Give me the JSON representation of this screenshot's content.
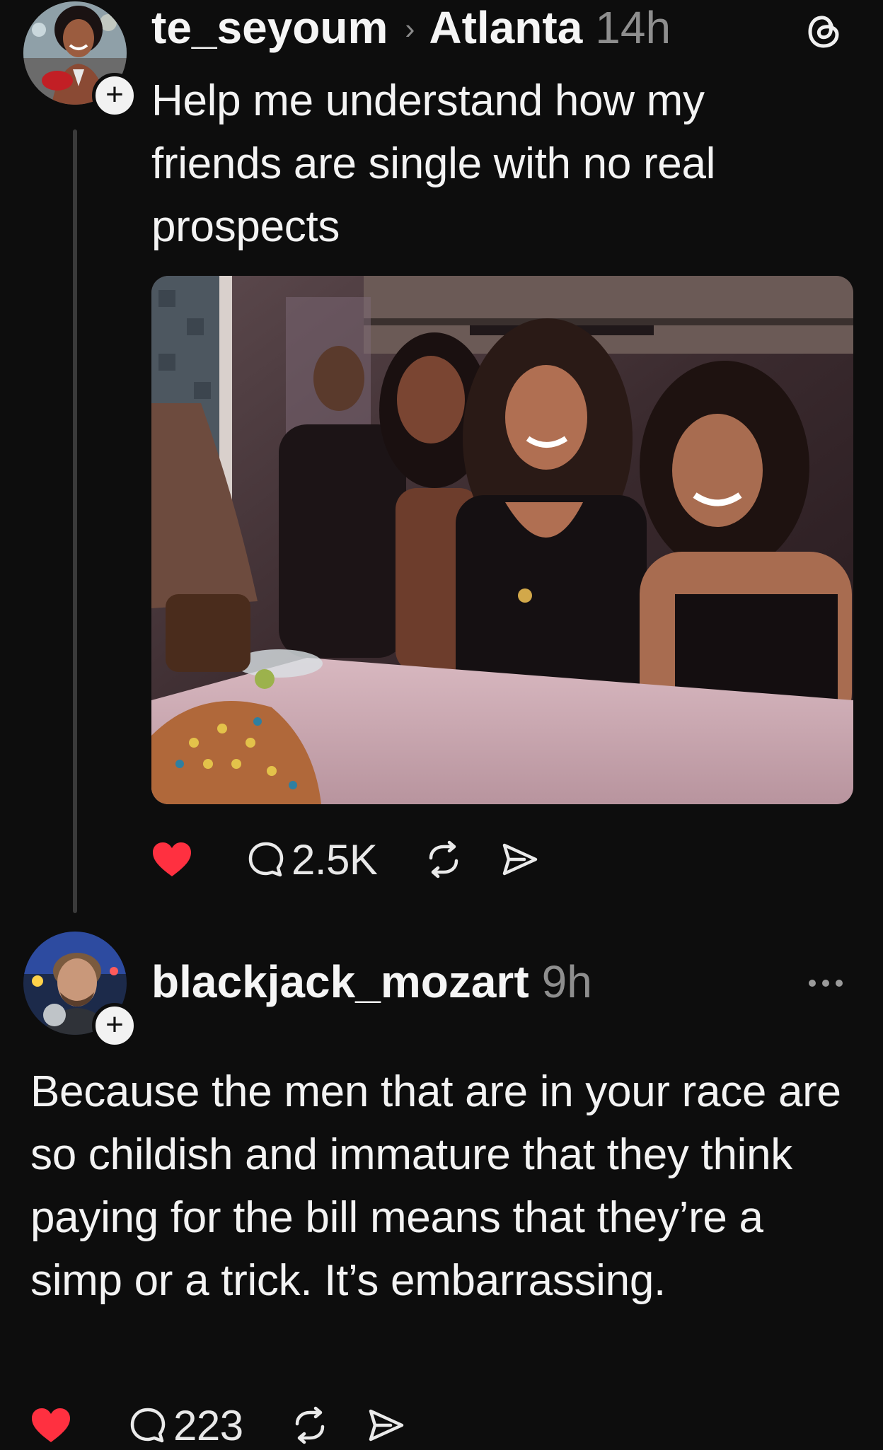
{
  "post": {
    "username": "te_seyoum",
    "location": "Atlanta",
    "time": "14h",
    "text": "Help me understand how my friends are single with no real prospects",
    "liked": true,
    "reply_count": "2.5K",
    "follow_symbol": "+"
  },
  "reply": {
    "username": "blackjack_mozart",
    "time": "9h",
    "text": "Because the men that are in your race are so childish and immature that they think paying for the bill means that they’re a simp or a trick. It’s embarrassing.",
    "liked": true,
    "reply_count": "223",
    "follow_symbol": "+"
  },
  "icons": {
    "location_chevron": "›",
    "header_right": "threads-logo-icon",
    "reply_more": "more-options-icon"
  },
  "colors": {
    "background": "#0d0d0d",
    "like_red": "#ff3040",
    "muted_text": "#8e8e8e",
    "thread_line": "#3a3a3a"
  }
}
